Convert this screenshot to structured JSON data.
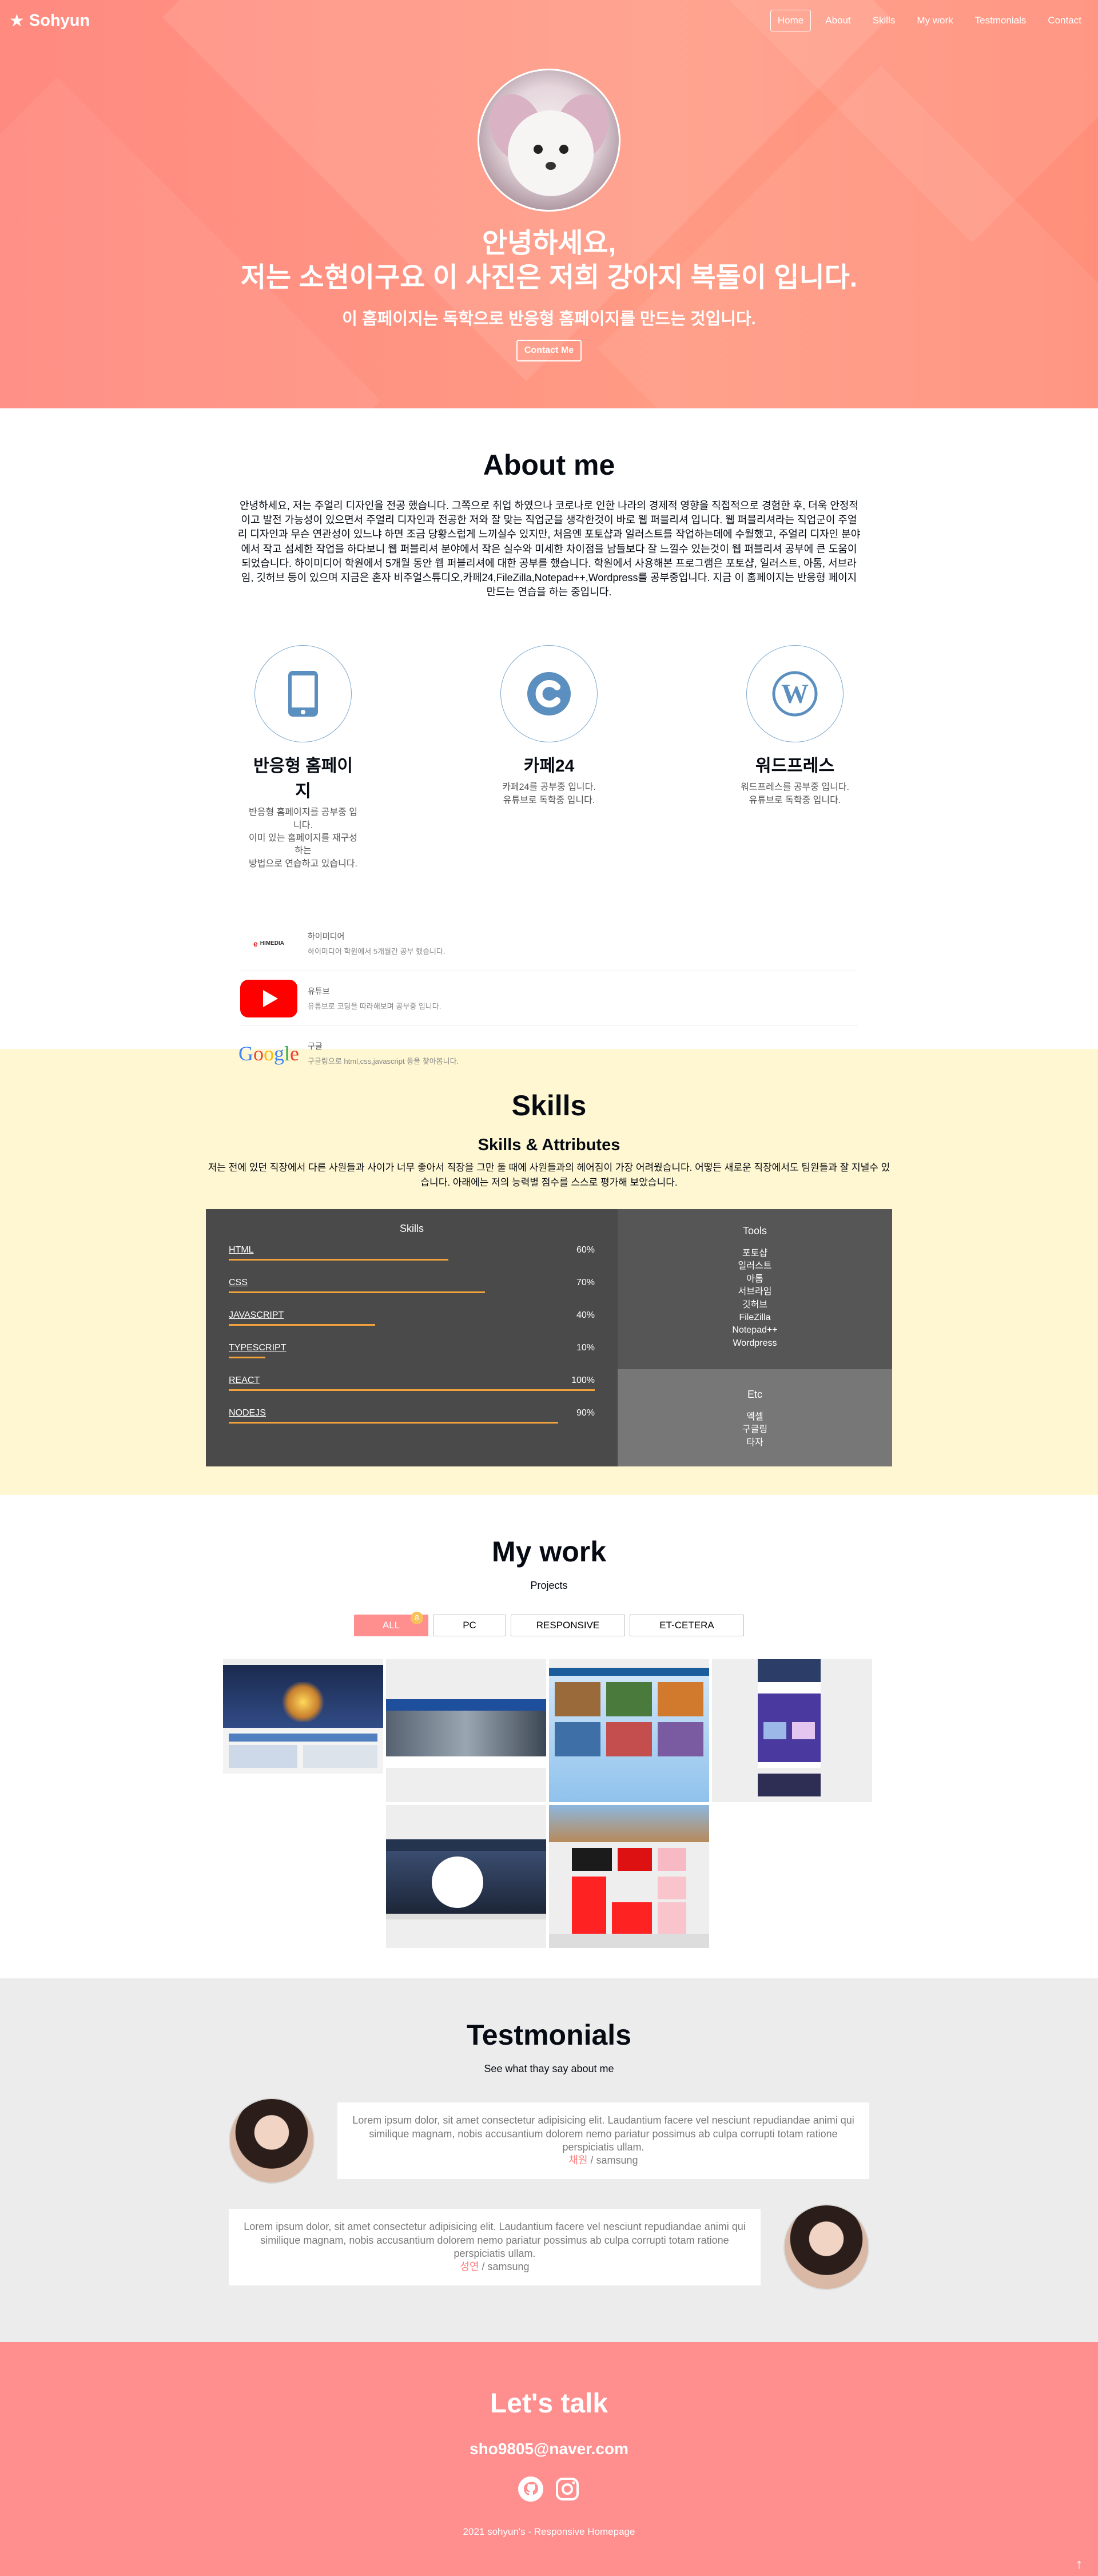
{
  "navbar": {
    "logo": "Sohyun",
    "menu": [
      "Home",
      "About",
      "Skills",
      "My work",
      "Testmonials",
      "Contact"
    ],
    "active_index": 0
  },
  "home": {
    "title_line1": "안녕하세요,",
    "title_line2": "저는 소현이구요 이 사진은 저희 강아지 복돌이 입니다.",
    "description": "이 홈페이지는 독학으로 반응형 홈페이지를 만드는 것입니다.",
    "contact_button": "Contact Me"
  },
  "about": {
    "title": "About me",
    "description": "안녕하세요, 저는 주얼리 디자인을 전공 했습니다. 그쪽으로 취업 하였으나 코로나로 인한 나라의 경제적 영향을 직접적으로 경험한 후, 더욱 안정적이고 발전 가능성이 있으면서 주얼리 디자인과 전공한 저와 잘 맞는 직업군을 생각한것이 바로 웹 퍼블리셔 입니다. 웹 퍼블리셔라는 직업군이 주얼리 디자인과 무슨 연관성이 있느냐 하면 조금 당황스럽게 느끼실수 있지만, 처음엔 포토샵과 일러스트를 작업하는데에 수월했고, 주얼리 디자인 분야에서 작고 섬세한 작업을 하다보니 웹 퍼블리셔 분야에서 작은 실수와 미세한 차이점을 남들보다 잘 느낄수 있는것이 웹 퍼블리셔 공부에 큰 도움이 되었습니다. 하이미디어 학원에서 5개월 동안 웹 퍼블리셔에 대한 공부를 했습니다. 학원에서 사용해본 프로그램은 포토샵, 일러스트, 아톰, 서브라임, 깃허브 등이 있으며 지금은 혼자 비주얼스튜디오,카페24,FileZilla,Notepad++,Wordpress를 공부중입니다. 지금 이 홈페이지는 반응형 페이지 만드는 연습을 하는 중입니다.",
    "majors": [
      {
        "icon": "mobile-icon",
        "title": "반응형 홈페이지",
        "lines": [
          "반응형 홈페이지를 공부중 입니다.",
          "이미 있는 홈페이지를 재구성 하는",
          "방법으로 연습하고 있습니다."
        ]
      },
      {
        "icon": "cafe24-icon",
        "title": "카페24",
        "lines": [
          "카페24를 공부중 입니다.",
          "유튜브로 독학중 입니다."
        ]
      },
      {
        "icon": "wordpress-icon",
        "title": "워드프레스",
        "lines": [
          "워드프레스를 공부중 입니다.",
          "유튜브로 독학중 입니다."
        ]
      }
    ],
    "jobs": [
      {
        "logo": "himedia-logo",
        "logo_text": "HIMEDIA",
        "name": "하이미디어",
        "period": "하이미디어 학원에서 5개월간 공부 했습니다."
      },
      {
        "logo": "youtube-logo",
        "name": "유튜브",
        "period": "유튜브로 코딩을 따라해보며 공부중 입니다."
      },
      {
        "logo": "google-logo",
        "logo_text": "Google",
        "name": "구글",
        "period": "구글링으로 html,css,javascript 등을 찾아봅니다."
      }
    ]
  },
  "skills": {
    "title": "Skills",
    "subtitle": "Skills & Attributes",
    "description": "저는 전에 있던 직장에서 다른 사원들과 사이가 너무 좋아서 직장을 그만 둘 때에 사원들과의 헤어짐이 가장 어려웠습니다. 어떻든 새로운 직장에서도 팀원들과 잘 지낼수 있습니다. 아래에는 저의 능력별 점수를 스스로 평가해 보았습니다.",
    "skills_title": "Skills",
    "items": [
      {
        "name": "HTML",
        "value": "60%",
        "percent": 60
      },
      {
        "name": "CSS",
        "value": "70%",
        "percent": 70
      },
      {
        "name": "JAVASCRIPT",
        "value": "40%",
        "percent": 40
      },
      {
        "name": "TYPESCRIPT",
        "value": "10%",
        "percent": 10
      },
      {
        "name": "REACT",
        "value": "100%",
        "percent": 100
      },
      {
        "name": "NODEJS",
        "value": "90%",
        "percent": 90
      }
    ],
    "tools_title": "Tools",
    "tools": [
      "포토샵",
      "일러스트",
      "아톰",
      "서브라임",
      "깃허브",
      "FileZilla",
      "Notepad++",
      "Wordpress"
    ],
    "etc_title": "Etc",
    "etc": [
      "엑셀",
      "구글링",
      "타자"
    ],
    "bar_color": "#f2a33c"
  },
  "work": {
    "title": "My work",
    "subtitle": "Projects",
    "categories": [
      {
        "label": "ALL",
        "count": "8"
      },
      {
        "label": "PC"
      },
      {
        "label": "RESPONSIVE"
      },
      {
        "label": "ET-CETERA"
      }
    ]
  },
  "testimonials": {
    "title": "Testmonials",
    "subtitle": "See what thay say about me",
    "items": [
      {
        "text": "Lorem ipsum dolor, sit amet consectetur adipisicing elit. Laudantium facere vel nesciunt repudiandae animi qui similique magnam, nobis accusantium dolorem nemo pariatur possimus ab culpa corrupti totam ratione perspiciatis ullam.",
        "name": "채원",
        "company": " / samsung"
      },
      {
        "text": "Lorem ipsum dolor, sit amet consectetur adipisicing elit. Laudantium facere vel nesciunt repudiandae animi qui similique magnam, nobis accusantium dolorem nemo pariatur possimus ab culpa corrupti totam ratione perspiciatis ullam.",
        "name": "성연",
        "company": " / samsung"
      }
    ]
  },
  "contact": {
    "title": "Let's talk",
    "email": "sho9805@naver.com",
    "links": [
      "github-icon",
      "instagram-icon"
    ],
    "rights": "2021 sohyun's - Responsive Homepage"
  },
  "colors": {
    "accent": "#ff8f8f",
    "skills_bg": "#fff7d2",
    "testimonial_bg": "#ececec"
  }
}
